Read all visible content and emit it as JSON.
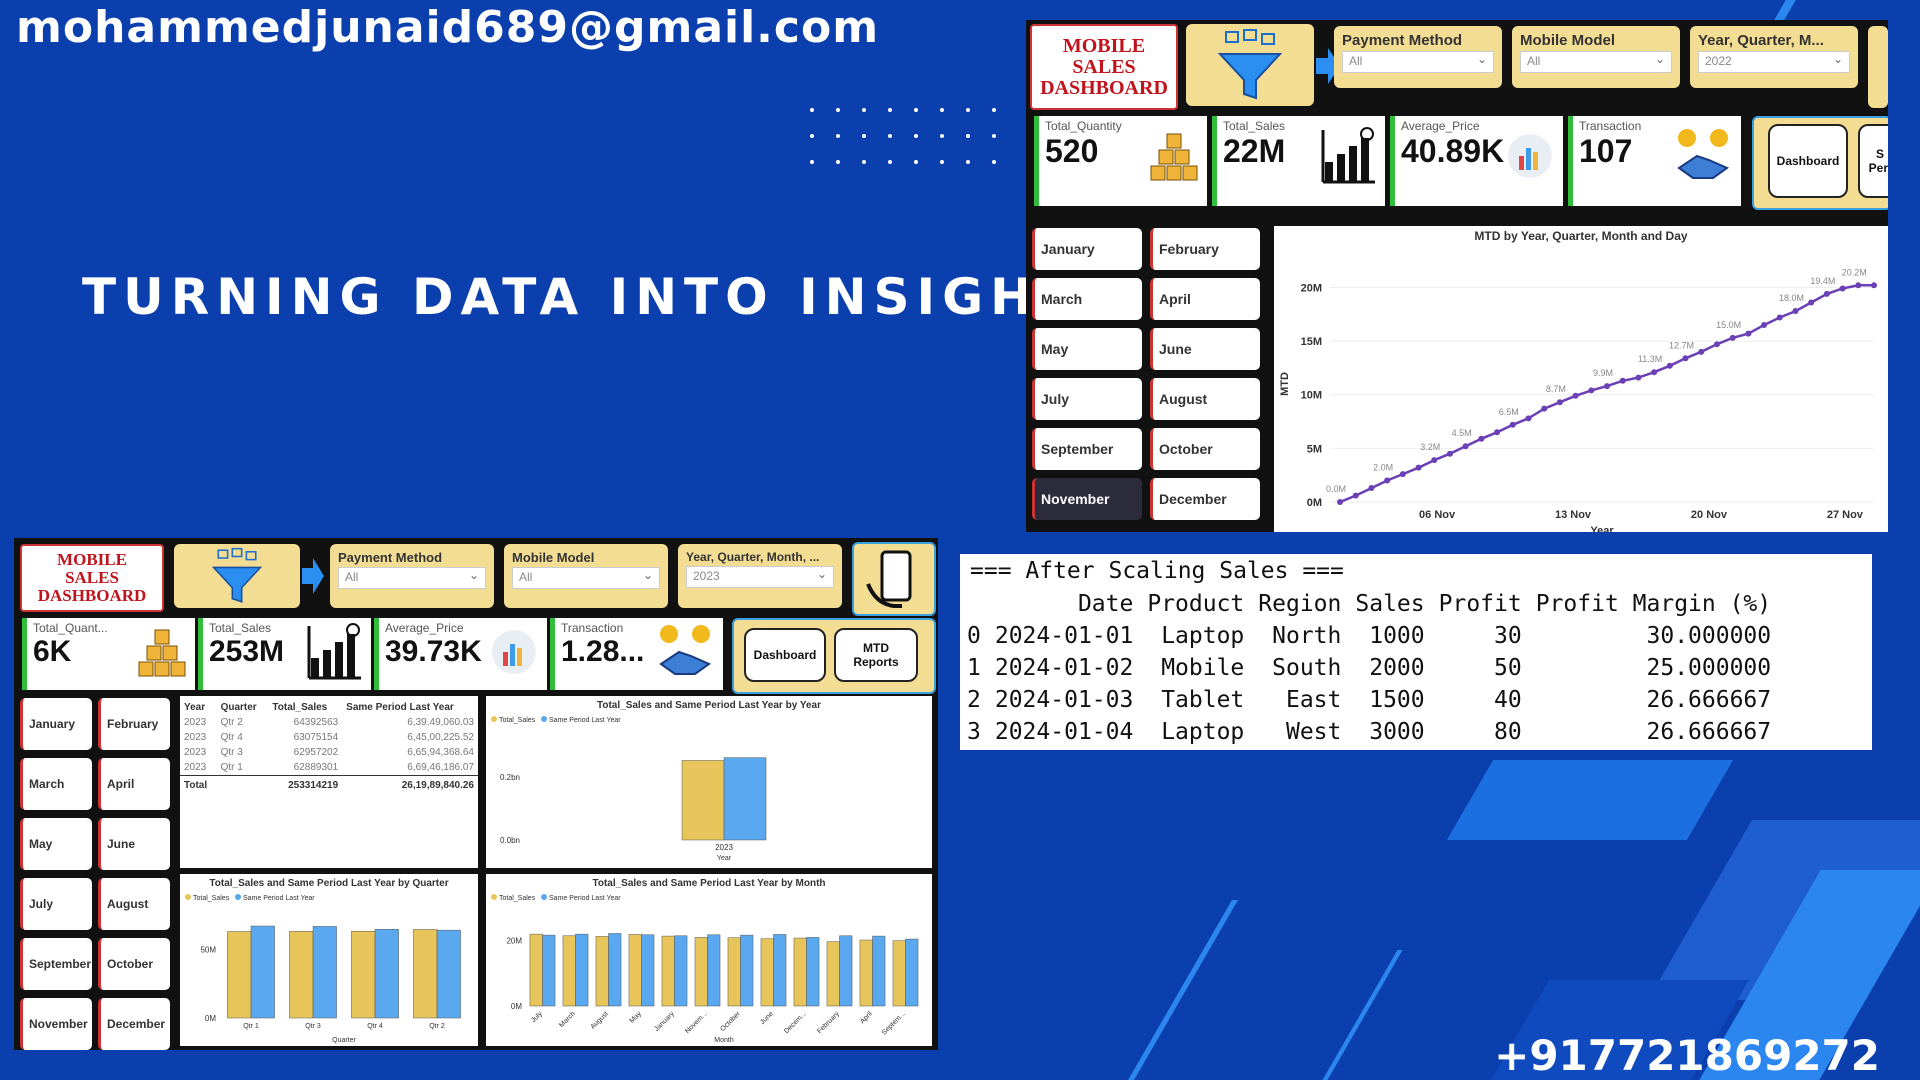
{
  "contact": {
    "email": "mohammedjunaid689@gmail.com",
    "phone": "+917721869272"
  },
  "headline": "TURNING DATA INTO INSIGHTS",
  "dashboard_top": {
    "title_lines": [
      "MOBILE",
      "SALES",
      "DASHBOARD"
    ],
    "filters": [
      {
        "label": "Payment Method",
        "value": "All"
      },
      {
        "label": "Mobile Model",
        "value": "All"
      },
      {
        "label": "Year, Quarter, M...",
        "value": "2022"
      }
    ],
    "kpis": [
      {
        "label": "Total_Quantity",
        "value": "520",
        "icon": "boxes-icon"
      },
      {
        "label": "Total_Sales",
        "value": "22M",
        "icon": "growth-chart-icon"
      },
      {
        "label": "Average_Price",
        "value": "40.89K",
        "icon": "price-chart-icon"
      },
      {
        "label": "Transaction",
        "value": "107",
        "icon": "handshake-icon"
      }
    ],
    "nav_buttons": [
      "Dashboard",
      "S\nPeri"
    ],
    "months": [
      "January",
      "February",
      "March",
      "April",
      "May",
      "June",
      "July",
      "August",
      "September",
      "October",
      "November",
      "December"
    ],
    "selected_month": "November",
    "chart_data": {
      "type": "line",
      "title": "MTD by Year, Quarter, Month and Day",
      "xlabel": "Year",
      "ylabel": "MTD",
      "y_ticks": [
        "0M",
        "5M",
        "10M",
        "15M",
        "20M"
      ],
      "x_ticks": [
        "06 Nov",
        "13 Nov",
        "20 Nov",
        "27 Nov"
      ],
      "ylim": [
        0,
        22
      ],
      "values": [
        0.0,
        0.6,
        1.3,
        2.0,
        2.6,
        3.2,
        3.9,
        4.5,
        5.2,
        5.9,
        6.5,
        7.2,
        7.8,
        8.7,
        9.3,
        9.9,
        10.4,
        10.8,
        11.3,
        11.6,
        12.1,
        12.7,
        13.4,
        14.0,
        14.7,
        15.3,
        15.7,
        16.5,
        17.2,
        17.8,
        18.6,
        19.4,
        19.9,
        20.2,
        20.2
      ],
      "point_labels": [
        {
          "i": 0,
          "text": "0.0M"
        },
        {
          "i": 3,
          "text": "2.0M"
        },
        {
          "i": 6,
          "text": "3.2M"
        },
        {
          "i": 8,
          "text": "4.5M"
        },
        {
          "i": 11,
          "text": "6.5M"
        },
        {
          "i": 14,
          "text": "8.7M"
        },
        {
          "i": 17,
          "text": "9.9M"
        },
        {
          "i": 20,
          "text": "11.3M"
        },
        {
          "i": 22,
          "text": "12.7M"
        },
        {
          "i": 25,
          "text": "15.0M"
        },
        {
          "i": 29,
          "text": "18.0M"
        },
        {
          "i": 31,
          "text": "19.4M"
        },
        {
          "i": 33,
          "text": "20.2M"
        }
      ],
      "color": "#6b3fb5"
    }
  },
  "dashboard_bottom": {
    "title_lines": [
      "MOBILE",
      "SALES",
      "DASHBOARD"
    ],
    "filters": [
      {
        "label": "Payment Method",
        "value": "All"
      },
      {
        "label": "Mobile Model",
        "value": "All"
      },
      {
        "label": "Year, Quarter, Month, ...",
        "value": "2023"
      }
    ],
    "kpis": [
      {
        "label": "Total_Quant...",
        "value": "6K",
        "icon": "boxes-icon"
      },
      {
        "label": "Total_Sales",
        "value": "253M",
        "icon": "growth-chart-icon"
      },
      {
        "label": "Average_Price",
        "value": "39.73K",
        "icon": "price-chart-icon"
      },
      {
        "label": "Transaction",
        "value": "1.28...",
        "icon": "handshake-icon"
      }
    ],
    "nav_buttons": [
      "Dashboard",
      "MTD\nReports"
    ],
    "months": [
      "January",
      "February",
      "March",
      "April",
      "May",
      "June",
      "July",
      "August",
      "September",
      "October",
      "November",
      "December"
    ],
    "table": {
      "headers": [
        "Year",
        "Quarter",
        "Total_Sales",
        "Same Period Last Year"
      ],
      "rows": [
        [
          "2023",
          "Qtr 2",
          "64392563",
          "6,39,49,060.03"
        ],
        [
          "2023",
          "Qtr 4",
          "63075154",
          "6,45,00,225.52"
        ],
        [
          "2023",
          "Qtr 3",
          "62957202",
          "6,65,94,368.64"
        ],
        [
          "2023",
          "Qtr 1",
          "62889301",
          "6,69,46,186.07"
        ]
      ],
      "total": [
        "Total",
        "",
        "253314219",
        "26,19,89,840.26"
      ]
    },
    "chart_data": [
      {
        "type": "bar",
        "title": "Total_Sales and Same Period Last Year by Year",
        "xlabel": "Year",
        "categories": [
          "2023"
        ],
        "legend": [
          "Total_Sales",
          "Same Period Last Year"
        ],
        "y_ticks": [
          "0.0bn",
          "0.2bn"
        ],
        "ylim": [
          0,
          0.35
        ],
        "series": [
          {
            "name": "Total_Sales",
            "values": [
              0.253
            ]
          },
          {
            "name": "Same Period Last Year",
            "values": [
              0.262
            ]
          }
        ]
      },
      {
        "type": "bar",
        "title": "Total_Sales and Same Period Last Year by Quarter",
        "xlabel": "Quarter",
        "categories": [
          "Qtr 1",
          "Qtr 3",
          "Qtr 4",
          "Qtr 2"
        ],
        "legend": [
          "Total_Sales",
          "Same Period Last Year"
        ],
        "y_ticks": [
          "0M",
          "50M"
        ],
        "ylim": [
          0,
          80
        ],
        "series": [
          {
            "name": "Total_Sales",
            "values": [
              62.9,
              63.0,
              63.1,
              64.4
            ]
          },
          {
            "name": "Same Period Last Year",
            "values": [
              66.9,
              66.6,
              64.5,
              63.9
            ]
          }
        ]
      },
      {
        "type": "bar",
        "title": "Total_Sales and Same Period Last Year by Month",
        "xlabel": "Month",
        "categories": [
          "July",
          "March",
          "August",
          "May",
          "January",
          "Novem...",
          "October",
          "June",
          "Decem...",
          "February",
          "April",
          "Septem..."
        ],
        "legend": [
          "Total_Sales",
          "Same Period Last Year"
        ],
        "y_ticks": [
          "0M",
          "20M"
        ],
        "ylim": [
          0,
          30
        ],
        "series": [
          {
            "name": "Total_Sales",
            "values": [
              22.0,
              21.5,
              21.3,
              21.9,
              21.4,
              21.0,
              20.9,
              20.6,
              20.8,
              19.7,
              20.2,
              20.0
            ]
          },
          {
            "name": "Same Period Last Year",
            "values": [
              21.7,
              22.0,
              22.2,
              21.8,
              21.5,
              21.8,
              21.7,
              21.9,
              21.0,
              21.5,
              21.4,
              20.5
            ]
          }
        ]
      }
    ]
  },
  "code_output": {
    "header": "=== After Scaling Sales ===",
    "columns": [
      "",
      "Date",
      "Product",
      "Region",
      "Sales",
      "Profit",
      "Profit Margin (%)"
    ],
    "rows": [
      [
        "0",
        "2024-01-01",
        "Laptop",
        "North",
        "1000",
        "30",
        "30.000000"
      ],
      [
        "1",
        "2024-01-02",
        "Mobile",
        "South",
        "2000",
        "50",
        "25.000000"
      ],
      [
        "2",
        "2024-01-03",
        "Tablet",
        "East",
        "1500",
        "40",
        "26.666667"
      ],
      [
        "3",
        "2024-01-04",
        "Laptop",
        "West",
        "3000",
        "80",
        "26.666667"
      ]
    ]
  },
  "colors": {
    "background": "#0b3fae",
    "bar_yellow": "#e7c55a",
    "bar_blue": "#5aa8ef",
    "kpi_accent": "#2fbf3a",
    "title_red": "#c0131c"
  }
}
